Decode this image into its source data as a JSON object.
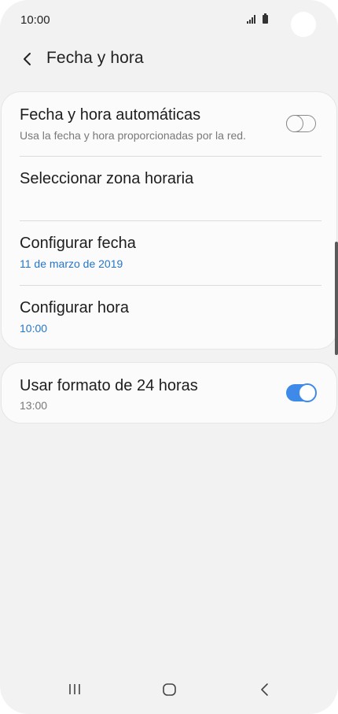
{
  "status_bar": {
    "time": "10:00"
  },
  "header": {
    "title": "Fecha y hora"
  },
  "settings": {
    "auto_datetime": {
      "title": "Fecha y hora automáticas",
      "subtitle": "Usa la fecha y hora proporcionadas por la red.",
      "enabled": false
    },
    "timezone": {
      "title": "Seleccionar zona horaria"
    },
    "set_date": {
      "title": "Configurar fecha",
      "value": "11 de marzo de 2019"
    },
    "set_time": {
      "title": "Configurar hora",
      "value": "10:00"
    },
    "format_24h": {
      "title": "Usar formato de 24 horas",
      "value": "13:00",
      "enabled": true
    }
  },
  "colors": {
    "accent": "#3e8ae8",
    "link": "#2576c7",
    "background": "#f2f2f2",
    "card": "#fbfbfb"
  },
  "nav_bar": {
    "icons": [
      "recent-apps-icon",
      "home-icon",
      "back-icon"
    ]
  }
}
